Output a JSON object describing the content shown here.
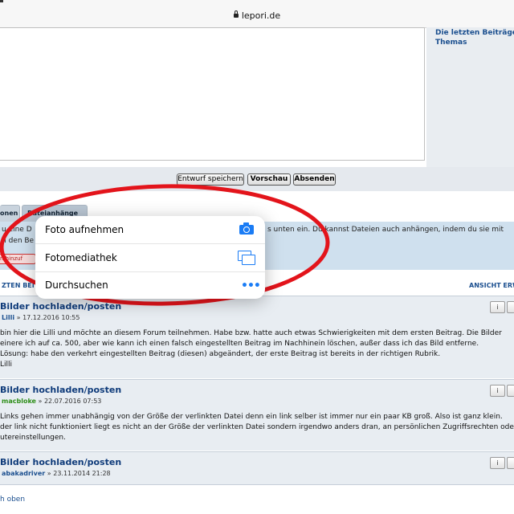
{
  "browser": {
    "url": "lepori.de"
  },
  "sidebar": {
    "link_line1": "Die letzten Beiträge",
    "link_line2": "Themas"
  },
  "editor": {
    "buttons": {
      "draft": "Entwurf speichern",
      "preview": "Vorschau",
      "submit": "Absenden"
    }
  },
  "tabs": {
    "tab1": "onen",
    "tab2": "Dateianhänge"
  },
  "attachments": {
    "info_left": "u eine D",
    "info_left2": "n den Be",
    "info_right": "s unten ein. Du kannst Dateien auch anhängen, indem du sie mit",
    "add_button": "n hinzuf"
  },
  "topic_header": {
    "left": "ZTEN BEITR",
    "right": "ANSICHT ERW"
  },
  "posts": [
    {
      "title": "Bilder hochladen/posten",
      "author": "Lilli",
      "date": "» 17.12.2016 10:55",
      "lines": [
        " bin hier die Lilli und möchte an diesem Forum teilnehmen. Habe bzw. hatte auch etwas Schwierigkeiten mit dem ersten Beitrag. Die Bilder",
        "einere ich auf ca. 500, aber wie kann ich einen falsch eingestellten Beitrag im Nachhinein löschen, außer dass ich das Bild entferne.",
        " Lösung: habe den verkehrt eingestellten Beitrag (diesen) abgeändert, der erste Beitrag ist bereits in der richtigen Rubrik.",
        "Lilli"
      ]
    },
    {
      "title": "Bilder hochladen/posten",
      "author": "macbloke",
      "date": "» 22.07.2016 07:53",
      "lines": [
        " Links gehen immer unabhängig von der Größe der verlinkten Datei denn ein link selber ist immer nur ein paar KB groß. Also ist ganz klein.",
        "der link nicht funktioniert liegt es nicht an der Größe der verlinkten Datei sondern irgendwo anders dran, an persönlichen Zugriffsrechten ode",
        "utereinstellungen."
      ]
    },
    {
      "title": "Bilder hochladen/posten",
      "author": "abakadriver",
      "date": "» 23.11.2014 21:28",
      "lines": []
    }
  ],
  "footer": {
    "link": "h oben"
  },
  "popover": {
    "items": [
      {
        "label": "Foto aufnehmen",
        "icon": "camera-icon"
      },
      {
        "label": "Fotomediathek",
        "icon": "photo-library-icon"
      },
      {
        "label": "Durchsuchen",
        "icon": "more-icon"
      }
    ]
  },
  "colors": {
    "accent": "#1a7cf5",
    "link": "#1b4f8f",
    "annotation_ring": "#e3141b"
  }
}
